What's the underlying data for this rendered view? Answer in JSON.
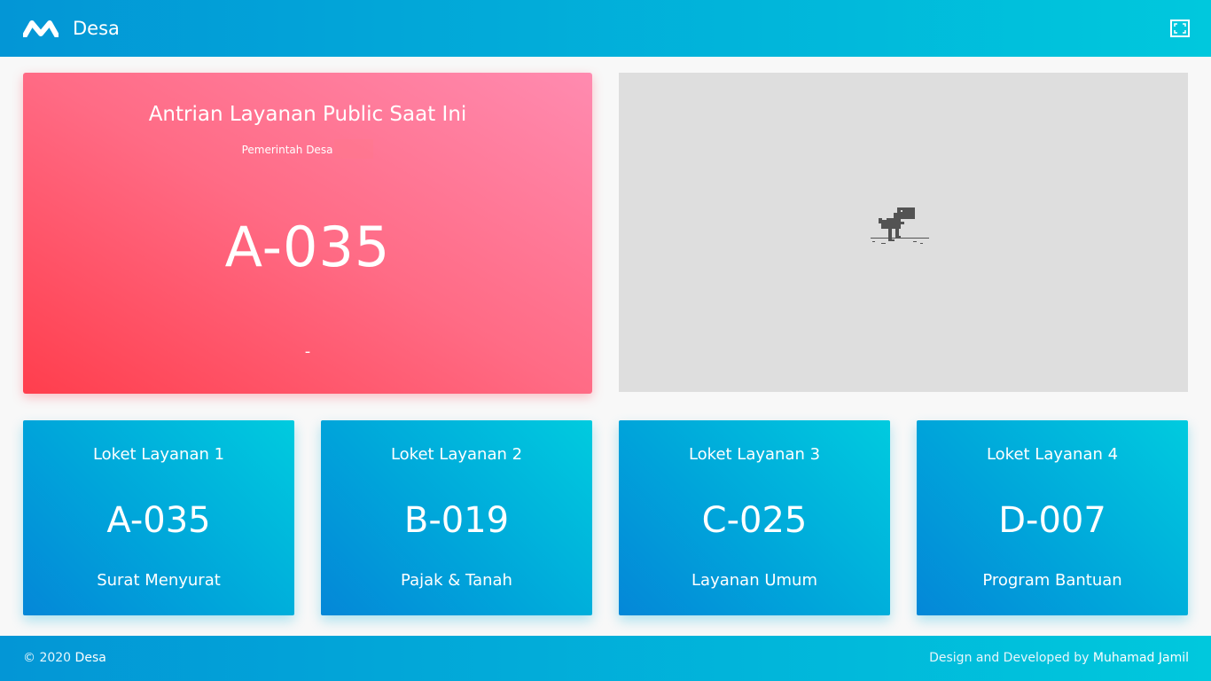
{
  "header": {
    "brand": "Desa",
    "logo_icon": "logo-icon",
    "fullscreen_icon": "fullscreen-icon"
  },
  "current_queue": {
    "title": "Antrian Layanan Public Saat Ini",
    "subtitle": "Pemerintah Desa",
    "number": "A-035",
    "counter_label": "-"
  },
  "media": {
    "icon": "dinosaur-icon"
  },
  "counters": [
    {
      "name": "Loket Layanan 1",
      "number": "A-035",
      "service": "Surat Menyurat"
    },
    {
      "name": "Loket Layanan 2",
      "number": "B-019",
      "service": "Pajak & Tanah"
    },
    {
      "name": "Loket Layanan 3",
      "number": "C-025",
      "service": "Layanan Umum"
    },
    {
      "name": "Loket Layanan 4",
      "number": "D-007",
      "service": "Program Bantuan"
    }
  ],
  "footer": {
    "copyright": "© 2020",
    "brand": "Desa",
    "credit_prefix": "Design and Developed by",
    "author": "Muhamad Jamil"
  },
  "colors": {
    "header_gradient_start": "#0396d6",
    "header_gradient_end": "#00c8dd",
    "current_gradient_start": "#ff3e4d",
    "current_gradient_end": "#ff8bb0",
    "media_background": "#dedede"
  }
}
